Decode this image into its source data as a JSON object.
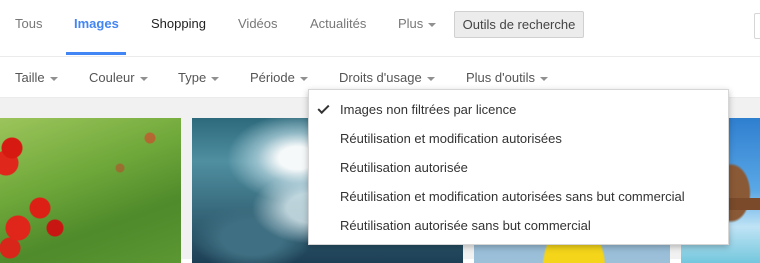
{
  "topnav": {
    "tabs": [
      {
        "label": "Tous"
      },
      {
        "label": "Images"
      },
      {
        "label": "Shopping"
      },
      {
        "label": "Vidéos"
      },
      {
        "label": "Actualités"
      },
      {
        "label": "Plus"
      }
    ],
    "active_tab": "Images",
    "tools_button": "Outils de recherche"
  },
  "tools": {
    "items": [
      "Taille",
      "Couleur",
      "Type",
      "Période",
      "Droits d'usage",
      "Plus d'outils"
    ]
  },
  "usage_rights_menu": {
    "options": [
      "Images non filtrées par licence",
      "Réutilisation et modification autorisées",
      "Réutilisation autorisée",
      "Réutilisation et modification autorisées sans but commercial",
      "Réutilisation autorisée sans but commercial"
    ],
    "selected": "Images non filtrées par licence"
  },
  "colors": {
    "accent": "#4285f4",
    "results_bg": "#f1f1f1"
  },
  "icons": [
    "chevron-down-icon",
    "checkmark-icon"
  ]
}
